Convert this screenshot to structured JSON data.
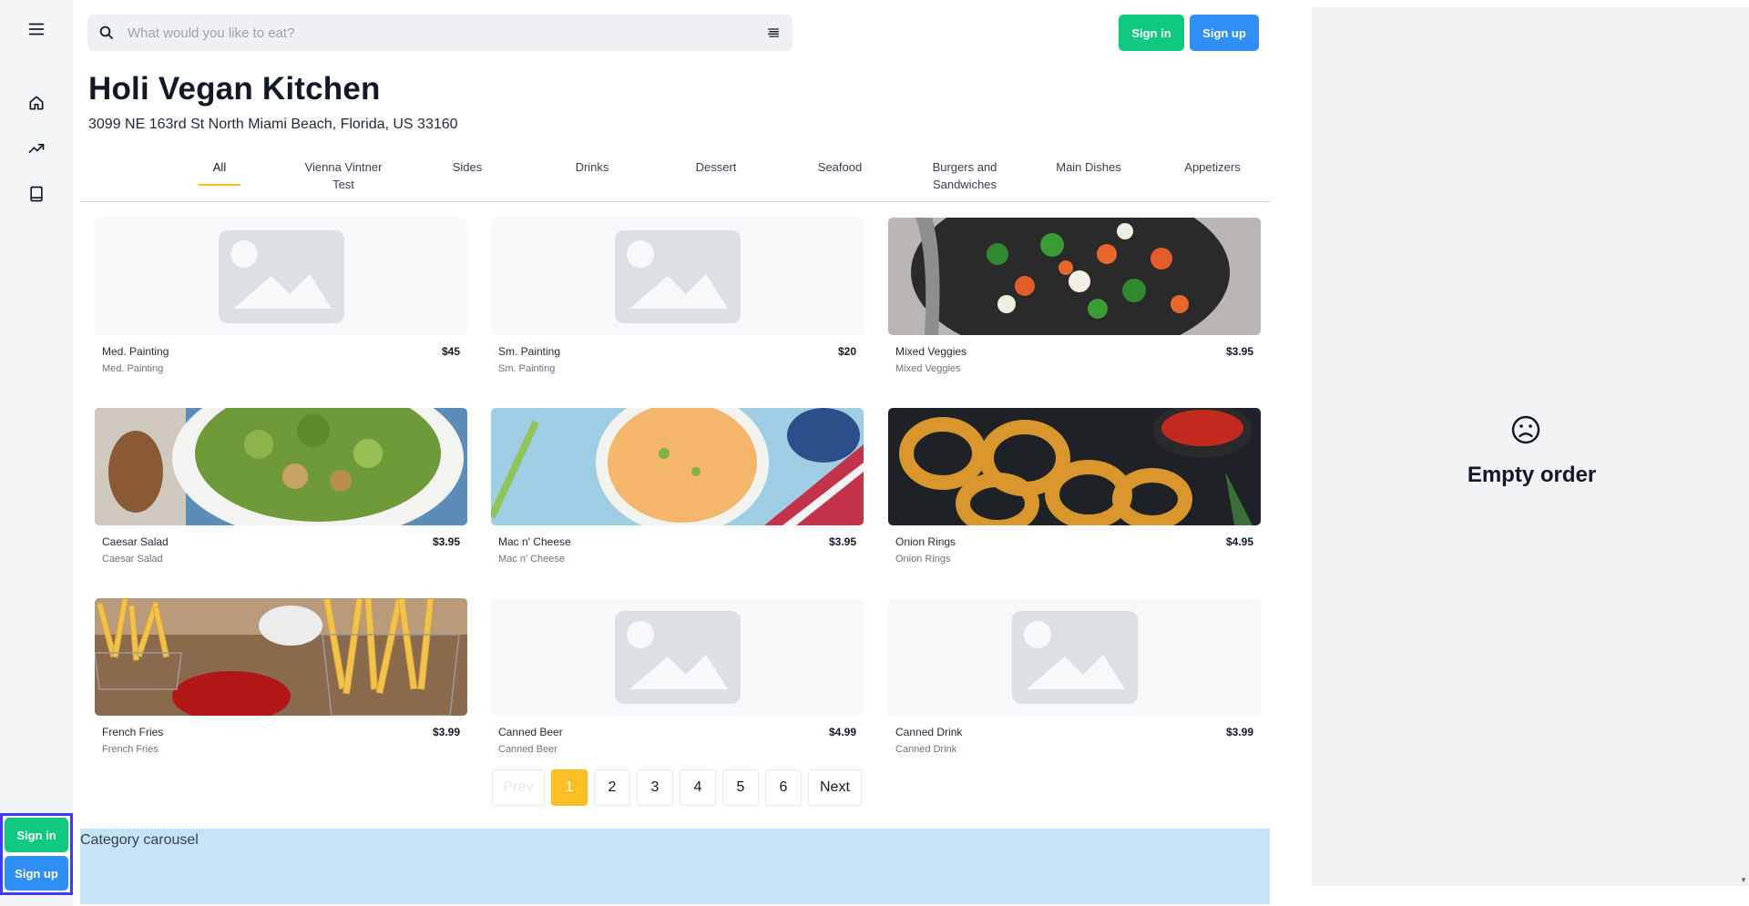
{
  "search": {
    "placeholder": "What would you like to eat?"
  },
  "auth": {
    "sign_in": "Sign in",
    "sign_up": "Sign up"
  },
  "restaurant": {
    "name": "Holi Vegan Kitchen",
    "address": "3099 NE 163rd St North Miami Beach, Florida, US 33160"
  },
  "tabs": [
    {
      "label": "All",
      "active": true
    },
    {
      "label": "Vienna Vintner Test"
    },
    {
      "label": "Sides"
    },
    {
      "label": "Drinks"
    },
    {
      "label": "Dessert"
    },
    {
      "label": "Seafood"
    },
    {
      "label": "Burgers and Sandwiches"
    },
    {
      "label": "Main Dishes"
    },
    {
      "label": "Appetizers"
    }
  ],
  "items": [
    {
      "name": "Med. Painting",
      "price": "$45",
      "desc": "Med. Painting",
      "image": "placeholder-image-icon"
    },
    {
      "name": "Sm. Painting",
      "price": "$20",
      "desc": "Sm. Painting",
      "image": "placeholder-image-icon"
    },
    {
      "name": "Mixed Veggies",
      "price": "$3.95",
      "desc": "Mixed Veggies",
      "image": "mixed-veggies-photo"
    },
    {
      "name": "Caesar Salad",
      "price": "$3.95",
      "desc": "Caesar Salad",
      "image": "caesar-salad-photo"
    },
    {
      "name": "Mac n' Cheese",
      "price": "$3.95",
      "desc": "Mac n' Cheese",
      "image": "mac-cheese-photo"
    },
    {
      "name": "Onion Rings",
      "price": "$4.95",
      "desc": "Onion Rings",
      "image": "onion-rings-photo"
    },
    {
      "name": "French Fries",
      "price": "$3.99",
      "desc": "French Fries",
      "image": "french-fries-photo"
    },
    {
      "name": "Canned Beer",
      "price": "$4.99",
      "desc": "Canned Beer",
      "image": "placeholder-image-icon"
    },
    {
      "name": "Canned Drink",
      "price": "$3.99",
      "desc": "Canned Drink",
      "image": "placeholder-image-icon"
    }
  ],
  "pagination": {
    "prev": "Prev",
    "next": "Next",
    "pages": [
      "1",
      "2",
      "3",
      "4",
      "5",
      "6"
    ],
    "current": "1"
  },
  "carousel": {
    "label": "Category carousel"
  },
  "order": {
    "empty_text": "Empty order",
    "icon": "sad-face-icon"
  },
  "colors": {
    "green": "#10c981",
    "blue": "#2f8ff5",
    "accent": "#fbbf24",
    "carousel_bg": "#c5e3f6"
  }
}
